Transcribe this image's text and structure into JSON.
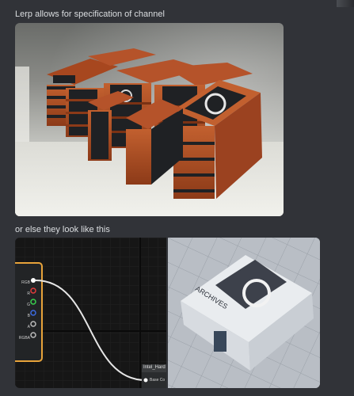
{
  "messages": {
    "first_text": "Lerp allows for specification of channel",
    "second_text": "or else they look like this"
  },
  "node_graph": {
    "pins": [
      "RGB",
      "R",
      "G",
      "B",
      "A",
      "RGBA"
    ],
    "target_node_title": "Intel_Hard",
    "target_pin": "Base Co"
  },
  "case_label": "ARCHIVES",
  "colors": {
    "background": "#313338",
    "case_orange": "#b5532a",
    "case_black": "#1f2124",
    "node_header": "#e8a33a",
    "wire": "#e6e6e6"
  }
}
